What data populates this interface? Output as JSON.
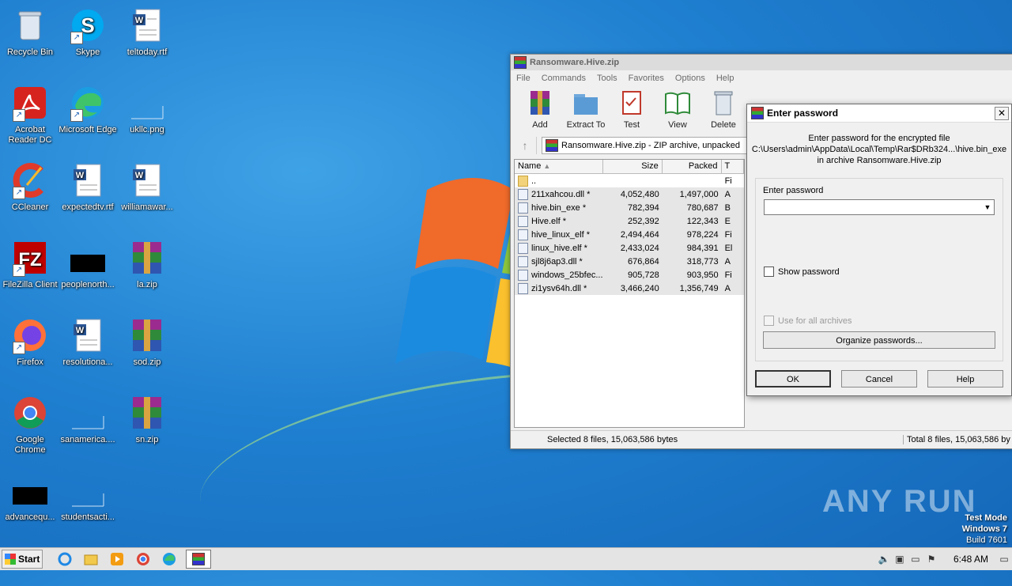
{
  "desktop": {
    "icons": [
      {
        "label": "Recycle Bin"
      },
      {
        "label": "Skype"
      },
      {
        "label": "teltoday.rtf"
      },
      {
        "label": "Acrobat Reader DC"
      },
      {
        "label": "Microsoft Edge"
      },
      {
        "label": "ukllc.png"
      },
      {
        "label": "CCleaner"
      },
      {
        "label": "expectedtv.rtf"
      },
      {
        "label": "williamawar..."
      },
      {
        "label": "FileZilla Client"
      },
      {
        "label": "peoplenorth..."
      },
      {
        "label": "la.zip"
      },
      {
        "label": "Firefox"
      },
      {
        "label": "resolutiona..."
      },
      {
        "label": "sod.zip"
      },
      {
        "label": "Google Chrome"
      },
      {
        "label": "sanamerica...."
      },
      {
        "label": "sn.zip"
      },
      {
        "label": "advancequ..."
      },
      {
        "label": "studentsacti..."
      }
    ]
  },
  "winrar": {
    "title": "Ransomware.Hive.zip",
    "menu": [
      "File",
      "Commands",
      "Tools",
      "Favorites",
      "Options",
      "Help"
    ],
    "toolbar": [
      "Add",
      "Extract To",
      "Test",
      "View",
      "Delete"
    ],
    "path": "Ransomware.Hive.zip - ZIP archive, unpacked",
    "columns": {
      "name": "Name",
      "size": "Size",
      "packed": "Packed",
      "type": "T"
    },
    "parent_row": {
      "name": "..",
      "type": "Fi"
    },
    "files": [
      {
        "name": "211xahcou.dll *",
        "size": "4,052,480",
        "packed": "1,497,000",
        "type": "A"
      },
      {
        "name": "hive.bin_exe *",
        "size": "782,394",
        "packed": "780,687",
        "type": "B"
      },
      {
        "name": "Hive.elf *",
        "size": "252,392",
        "packed": "122,343",
        "type": "E"
      },
      {
        "name": "hive_linux_elf *",
        "size": "2,494,464",
        "packed": "978,224",
        "type": "Fi"
      },
      {
        "name": "linux_hive.elf *",
        "size": "2,433,024",
        "packed": "984,391",
        "type": "El"
      },
      {
        "name": "sjl8j6ap3.dll *",
        "size": "676,864",
        "packed": "318,773",
        "type": "A"
      },
      {
        "name": "windows_25bfec...",
        "size": "905,728",
        "packed": "903,950",
        "type": "Fi"
      },
      {
        "name": "zi1ysv64h.dll *",
        "size": "3,466,240",
        "packed": "1,356,749",
        "type": "A"
      }
    ],
    "status_left": "Selected 8 files, 15,063,586 bytes",
    "status_right": "Total 8 files, 15,063,586 by"
  },
  "dialog": {
    "title": "Enter password",
    "info_line1": "Enter password for the encrypted file",
    "info_line2": "C:\\Users\\admin\\AppData\\Local\\Temp\\Rar$DRb324...\\hive.bin_exe",
    "info_line3": "in archive Ransomware.Hive.zip",
    "password_label": "Enter password",
    "password_value": "",
    "show_password": "Show password",
    "use_for_all": "Use for all archives",
    "organize": "Organize passwords...",
    "ok": "OK",
    "cancel": "Cancel",
    "help": "Help"
  },
  "watermark": {
    "brand": "ANY RUN",
    "test_mode": "Test Mode",
    "os": "Windows 7",
    "build": "Build 7601"
  },
  "taskbar": {
    "start": "Start",
    "clock": "6:48 AM"
  }
}
